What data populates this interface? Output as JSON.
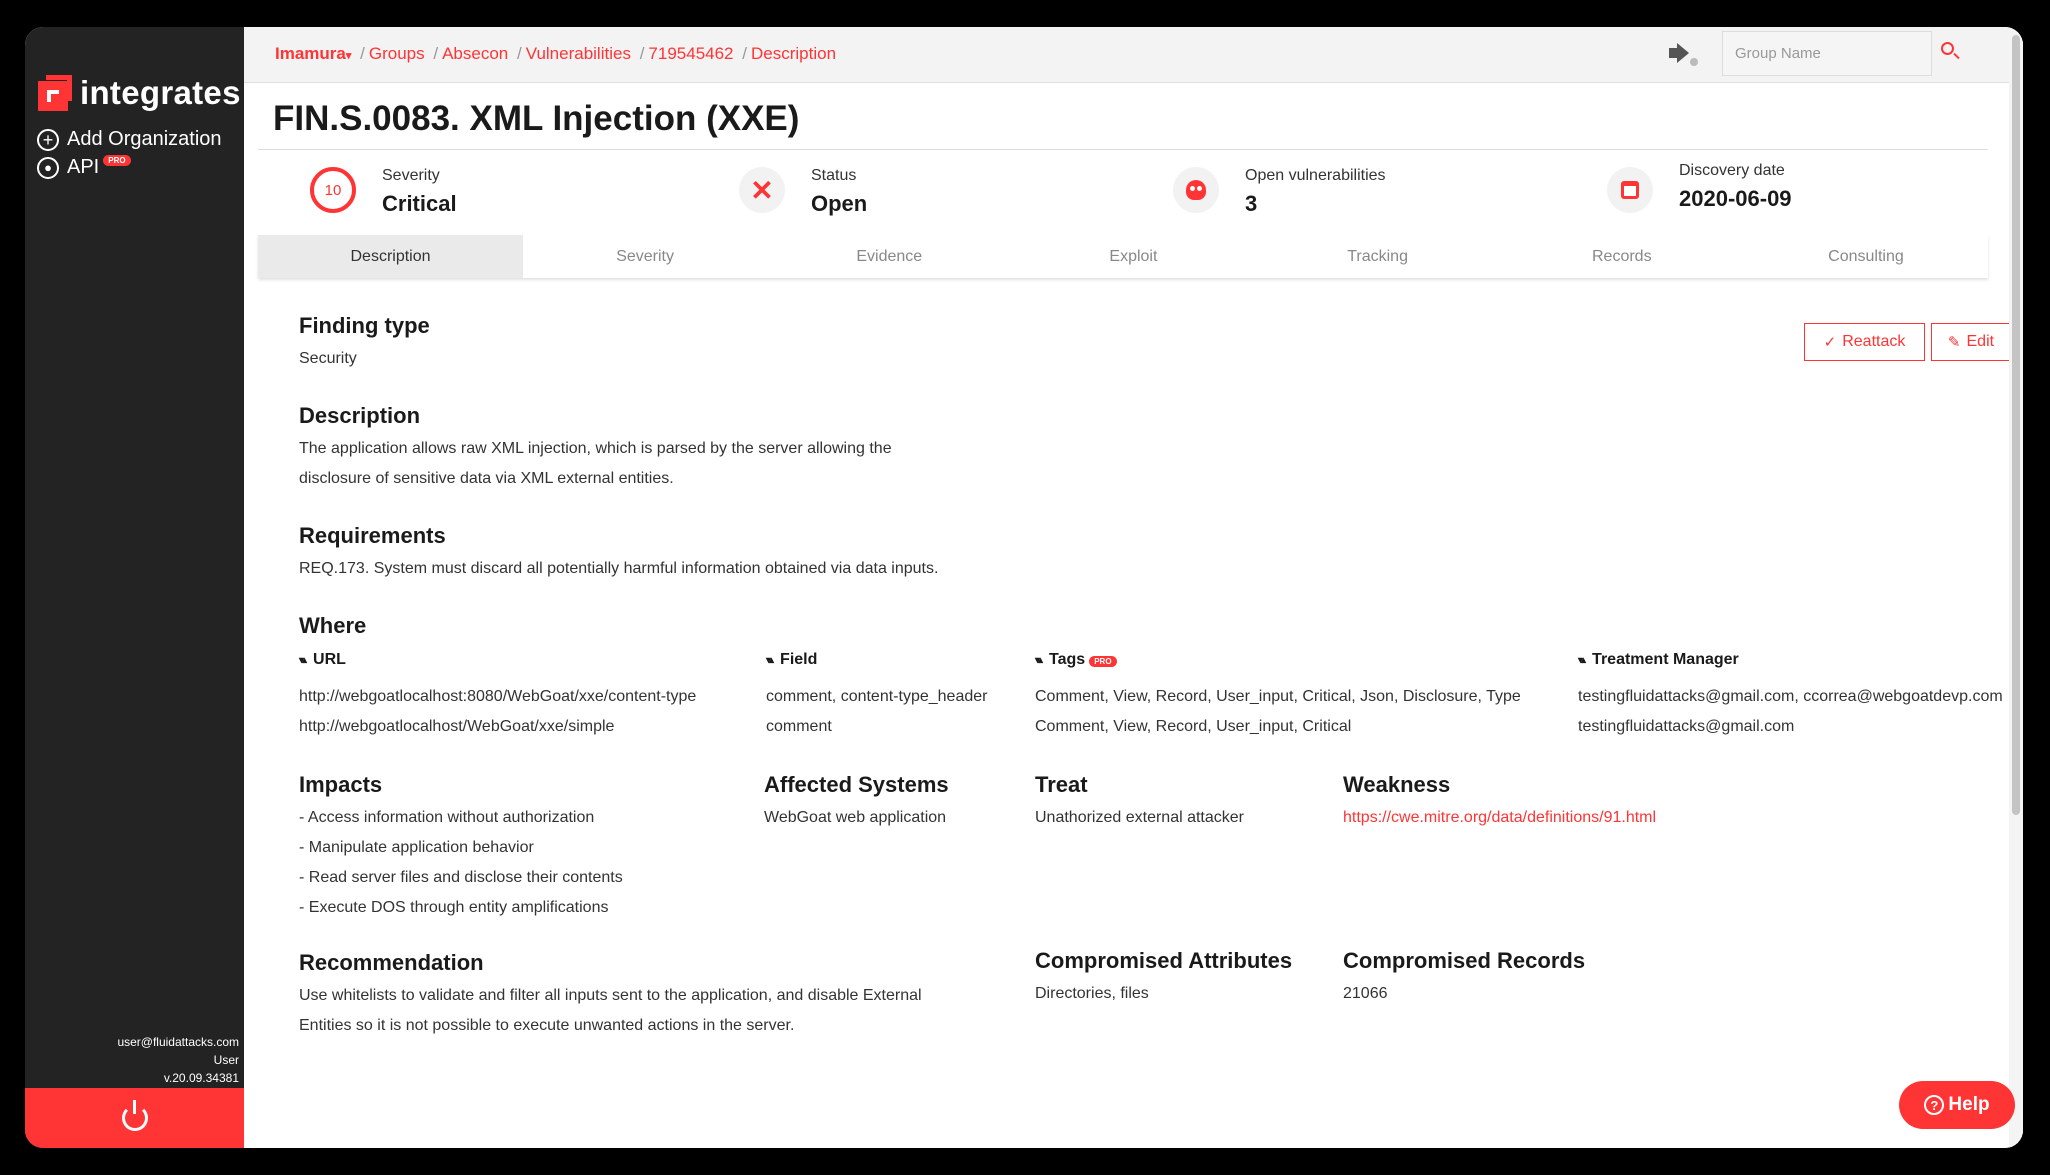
{
  "app": {
    "name": "integrates"
  },
  "sidebar": {
    "items": [
      {
        "label": "Add Organization",
        "icon": "plus-circle-icon"
      },
      {
        "label": "API",
        "icon": "user-circle-icon",
        "badge": "PRO"
      }
    ],
    "footer": {
      "email": "user@fluidattacks.com",
      "role": "User",
      "version": "v.20.09.34381"
    }
  },
  "breadcrumb": {
    "org": "Imamura",
    "org_caret": "▾",
    "items": [
      "Groups",
      "Absecon",
      "Vulnerabilities",
      "719545462",
      "Description"
    ],
    "sep": "/"
  },
  "search": {
    "placeholder": "Group Name",
    "value": ""
  },
  "finding": {
    "title": "FIN.S.0083. XML Injection (XXE)"
  },
  "indicators": {
    "severity": {
      "label": "Severity",
      "value": "Critical",
      "score": "10"
    },
    "status": {
      "label": "Status",
      "value": "Open",
      "icon_glyph": "✕"
    },
    "open_vulns": {
      "label": "Open vulnerabilities",
      "value": "3"
    },
    "discovery": {
      "label": "Discovery date",
      "value": "2020-06-09"
    }
  },
  "tabs": [
    "Description",
    "Severity",
    "Evidence",
    "Exploit",
    "Tracking",
    "Records",
    "Consulting"
  ],
  "buttons": {
    "reattack": "Reattack",
    "reattack_icon": "✓",
    "edit": "Edit",
    "edit_icon": "✎"
  },
  "sections": {
    "finding_type": {
      "heading": "Finding type",
      "value": "Security"
    },
    "description": {
      "heading": "Description",
      "lines": [
        "The application allows raw XML injection, which is parsed by the server allowing the",
        "disclosure of sensitive data via XML external entities."
      ]
    },
    "requirements": {
      "heading": "Requirements",
      "value": "REQ.173. System must discard all potentially harmful information obtained via data inputs."
    },
    "where": {
      "heading": "Where",
      "sort_glyph": "▾▴",
      "columns": {
        "url": {
          "label": "URL",
          "rows": [
            "http://webgoatlocalhost:8080/WebGoat/xxe/content-type",
            "http://webgoatlocalhost/WebGoat/xxe/simple"
          ]
        },
        "field": {
          "label": "Field",
          "rows": [
            "comment, content-type_header",
            "comment"
          ]
        },
        "tags": {
          "label": "Tags",
          "badge": "PRO",
          "rows": [
            "Comment, View, Record, User_input, Critical, Json, Disclosure, Type",
            "Comment, View, Record, User_input, Critical"
          ]
        },
        "treatment": {
          "label": "Treatment Manager",
          "rows": [
            "testingfluidattacks@gmail.com, ccorrea@webgoatdevp.com",
            "testingfluidattacks@gmail.com"
          ]
        }
      }
    },
    "impacts": {
      "heading": "Impacts",
      "lines": [
        "- Access information without authorization",
        "- Manipulate application behavior",
        "- Read server files and disclose their contents",
        "- Execute DOS through entity amplifications"
      ]
    },
    "affected_systems": {
      "heading": "Affected Systems",
      "value": "WebGoat web application"
    },
    "treat": {
      "heading": "Treat",
      "value": "Unathorized external attacker"
    },
    "weakness": {
      "heading": "Weakness",
      "value": "https://cwe.mitre.org/data/definitions/91.html"
    },
    "recommendation": {
      "heading": "Recommendation",
      "lines": [
        "Use whitelists to validate and filter all inputs sent to the application, and disable External",
        "Entities so it is not possible to execute unwanted actions in the server."
      ]
    },
    "compromised_attributes": {
      "heading": "Compromised Attributes",
      "value": "Directories, files"
    },
    "compromised_records": {
      "heading": "Compromised Records",
      "value": "21066"
    }
  },
  "help": {
    "label": "Help",
    "icon_glyph": "?"
  },
  "colors": {
    "accent": "#ff3435",
    "sidebar": "#232323"
  }
}
